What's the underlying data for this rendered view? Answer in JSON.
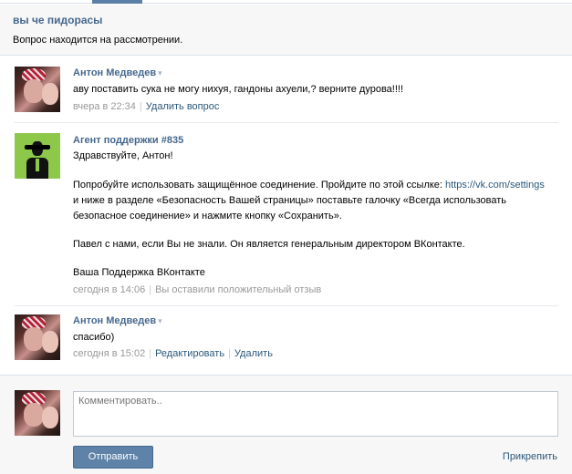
{
  "question": {
    "title": "вы че пидорасы",
    "status": "Вопрос находится на рассмотрении."
  },
  "messages": [
    {
      "author": "Антон Медведев",
      "caret": "▾",
      "text": "аву поставить сука не могу нихуя, гандоны ахуели,? верните дурова!!!!",
      "time": "вчера в 22:34",
      "actions": [
        "Удалить вопрос"
      ]
    },
    {
      "author": "Агент поддержки #835",
      "greeting": "Здравствуйте, Антон!",
      "para1_before": "Попробуйте использовать защищённое соединение. Пройдите по этой ссылке: ",
      "para1_link": "https://vk.com/settings",
      "para1_after": "и ниже в разделе «Безопасность Вашей страницы» поставьте галочку «Всегда использовать безопасное соединение» и нажмите кнопку «Сохранить».",
      "para2": "Павел с нами, если Вы не знали. Он является генеральным директором ВКонтакте.",
      "signature": "Ваша Поддержка ВКонтакте",
      "time": "сегодня в 14:06",
      "feedback": "Вы оставили положительный отзыв"
    },
    {
      "author": "Антон Медведев",
      "caret": "▾",
      "text": "спасибо)",
      "time": "сегодня в 15:02",
      "actions": [
        "Редактировать",
        "Удалить"
      ]
    }
  ],
  "reply": {
    "placeholder": "Комментировать..",
    "send_label": "Отправить",
    "attach_label": "Прикрепить"
  },
  "colors": {
    "link": "#2b587a",
    "author": "#45688e",
    "button": "#5e82a8",
    "support_avatar_bg": "#8ec84a"
  }
}
